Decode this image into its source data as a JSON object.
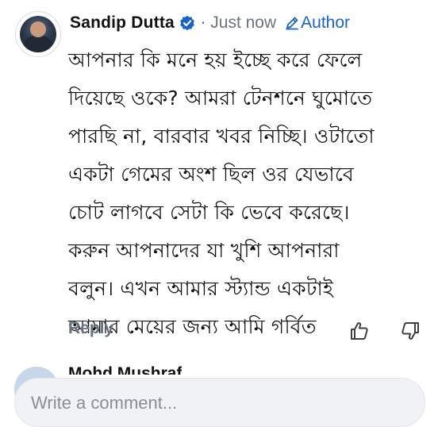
{
  "comment": {
    "author_name": "Sandip Dutta",
    "separator": "·",
    "timestamp": "Just now",
    "author_badge": "Author",
    "lines": [
      "আপনার কি মনে হয় ইচ্ছে করে ফেলে",
      "দিয়েছে ওকে? আমরা টেনশনে ঘুমোতে",
      "পারছি না, বারবার খবর নিচ্ছি। ওটাতো",
      "একটা গেমের অংশ ছিল ওর যেভাবে",
      "চোট লাগবে সেটা কি ভেবে করেছে।",
      "করুন আপনাদের যা খুশি আপনারা",
      "বলুন। এখন আমার স্ট্যান্ড একটাই",
      "আমার মেয়ের জন্য আমি গর্বিত"
    ],
    "reply_label": "Reply",
    "icons": {
      "verified": "verified-badge-icon",
      "author": "pencil-icon",
      "like": "thumbs-up-icon",
      "dislike": "thumbs-down-icon"
    }
  },
  "next_comment": {
    "author_name": "Mohd Mushraf"
  },
  "composer": {
    "placeholder": "Write a comment..."
  },
  "colors": {
    "accent": "#1a63c6",
    "muted": "#6b7280",
    "composer_bg": "#f0f2f5"
  }
}
